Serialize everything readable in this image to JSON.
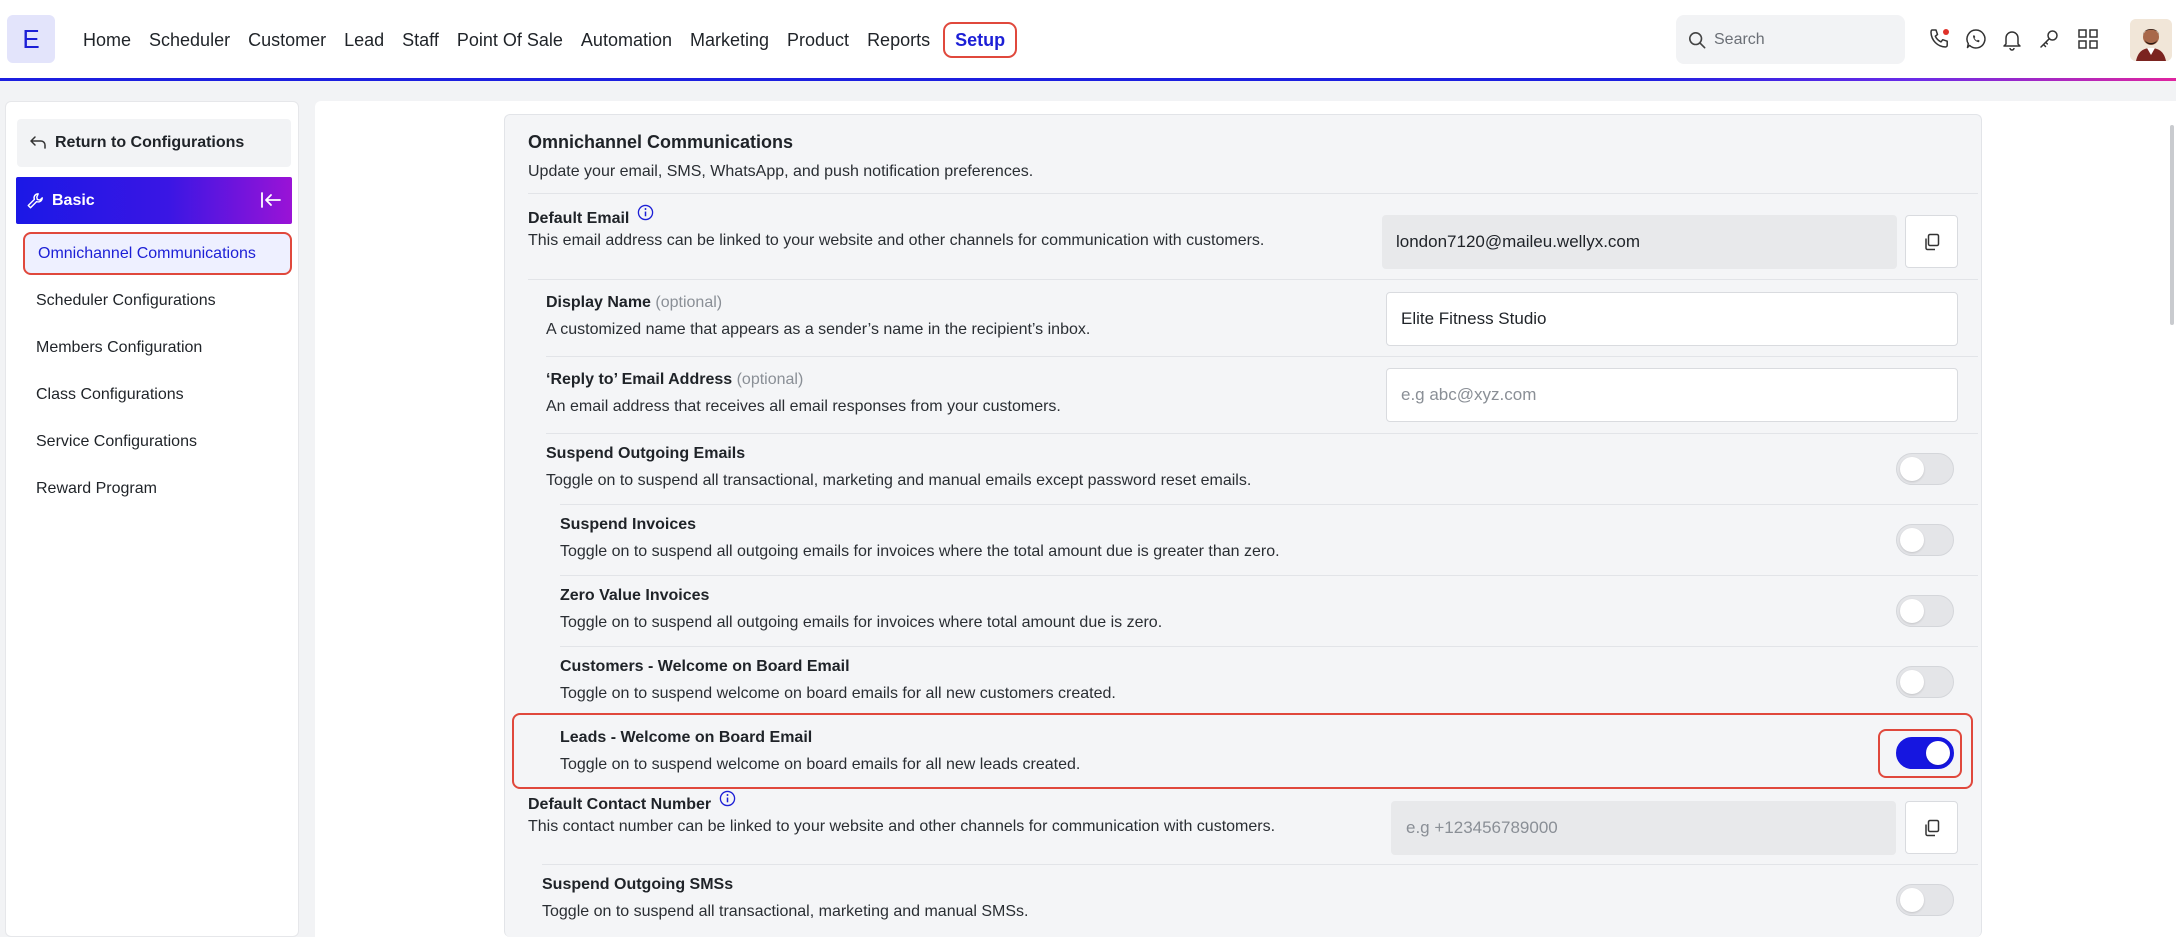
{
  "brand": {
    "logo_letter": "E"
  },
  "nav": {
    "items": [
      "Home",
      "Scheduler",
      "Customer",
      "Lead",
      "Staff",
      "Point Of Sale",
      "Automation",
      "Marketing",
      "Product",
      "Reports"
    ],
    "active": "Setup"
  },
  "search": {
    "placeholder": "Search"
  },
  "header_icons": [
    "phone-icon",
    "whatsapp-icon",
    "bell-icon",
    "key-icon",
    "apps-grid-icon"
  ],
  "sidebar": {
    "return_label": "Return to Configurations",
    "group_label": "Basic",
    "items": [
      {
        "label": "Omnichannel Communications",
        "active": true
      },
      {
        "label": "Scheduler Configurations",
        "active": false
      },
      {
        "label": "Members Configuration",
        "active": false
      },
      {
        "label": "Class Configurations",
        "active": false
      },
      {
        "label": "Service Configurations",
        "active": false
      },
      {
        "label": "Reward Program",
        "active": false
      }
    ]
  },
  "section": {
    "title": "Omnichannel Communications",
    "subtitle": "Update your email, SMS, WhatsApp, and push notification preferences.",
    "default_email": {
      "title": "Default Email",
      "desc": "This email address can be linked to your website and other channels for communication with customers.",
      "value": "london7120@maileu.wellyx.com"
    },
    "display_name": {
      "title": "Display Name",
      "optional": "(optional)",
      "desc": "A customized name that appears as a sender’s name in the recipient’s inbox.",
      "value": "Elite Fitness Studio"
    },
    "reply_to": {
      "title": "‘Reply to’ Email Address",
      "optional": "(optional)",
      "desc": "An email address that receives all email responses from your customers.",
      "placeholder": "e.g abc@xyz.com"
    },
    "suspend_emails": {
      "title": "Suspend Outgoing Emails",
      "desc": "Toggle on to suspend all transactional, marketing and manual emails except password reset emails.",
      "on": false
    },
    "suspend_invoices": {
      "title": "Suspend Invoices",
      "desc": "Toggle on to suspend all outgoing emails for invoices where the total amount due is greater than zero.",
      "on": false
    },
    "zero_value_invoices": {
      "title": "Zero Value Invoices",
      "desc": "Toggle on to suspend all outgoing emails for invoices where total amount due is zero.",
      "on": false
    },
    "customers_welcome": {
      "title": "Customers - Welcome on Board Email",
      "desc": "Toggle on to suspend welcome on board emails for all new customers created.",
      "on": false
    },
    "leads_welcome": {
      "title": "Leads - Welcome on Board Email",
      "desc": "Toggle on to suspend welcome on board emails for all new leads created.",
      "on": true
    },
    "default_contact": {
      "title": "Default Contact Number",
      "desc": "This contact number can be linked to your website and other channels for communication with customers.",
      "placeholder": "e.g +123456789000"
    },
    "suspend_sms": {
      "title": "Suspend Outgoing SMSs",
      "desc": "Toggle on to suspend all transactional, marketing and manual SMSs.",
      "on": false
    }
  },
  "colors": {
    "accent": "#1c1fd6",
    "highlight": "#e0483c",
    "toggle_on": "#1616e0"
  }
}
